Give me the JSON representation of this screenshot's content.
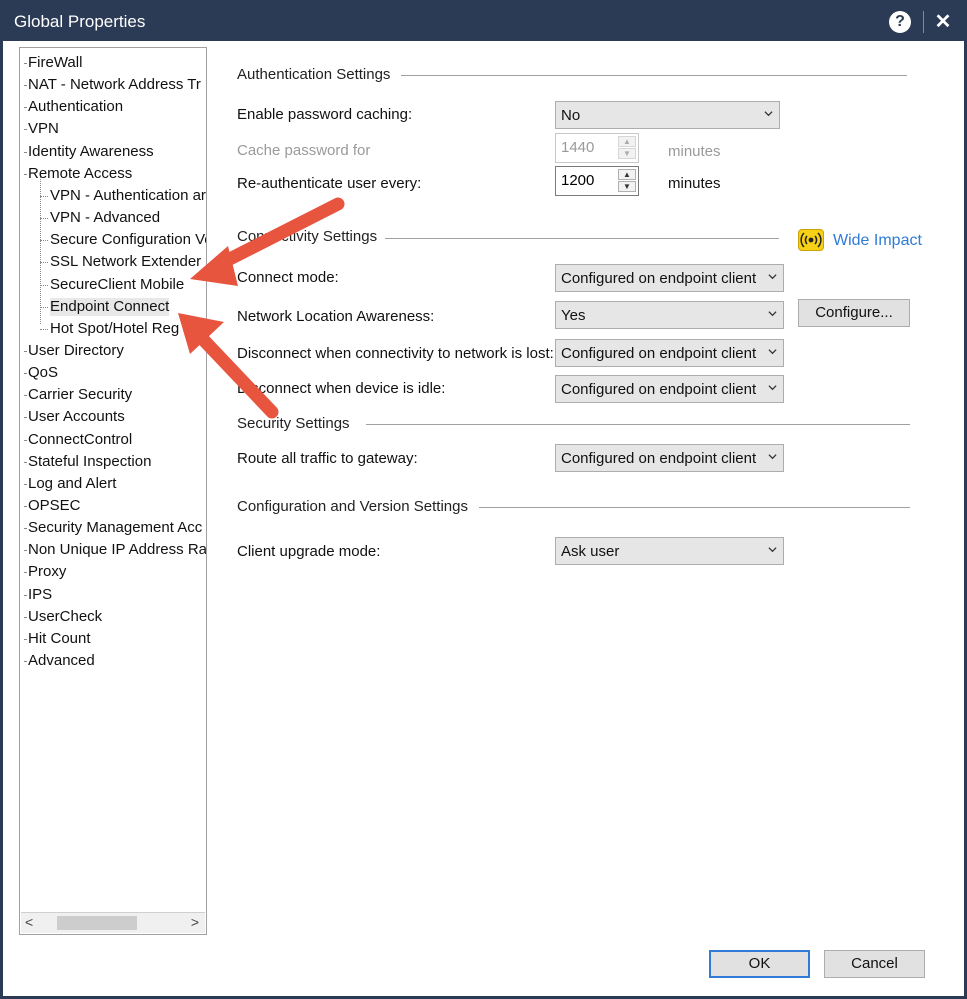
{
  "window": {
    "title": "Global Properties",
    "help_glyph": "?",
    "close_glyph": "✕"
  },
  "tree": {
    "items": [
      "FireWall",
      "NAT - Network Address Tr",
      "Authentication",
      "VPN",
      "Identity Awareness",
      "Remote Access",
      "VPN - Authentication ar",
      "VPN - Advanced",
      "Secure Configuration Ve",
      "SSL Network Extender",
      "SecureClient Mobile",
      "Endpoint Connect",
      "Hot Spot/Hotel Reg",
      "User Directory",
      "QoS",
      "Carrier Security",
      "User Accounts",
      "ConnectControl",
      "Stateful Inspection",
      "Log and Alert",
      "OPSEC",
      "Security Management Acc",
      "Non Unique IP Address Ra",
      "Proxy",
      "IPS",
      "UserCheck",
      "Hit Count",
      "Advanced"
    ],
    "selected": "Endpoint Connect",
    "scroll_left": "<",
    "scroll_right": ">"
  },
  "sections": {
    "authentication": "Authentication Settings",
    "connectivity": "Connectivity Settings",
    "security": "Security Settings",
    "config_version": "Configuration and Version Settings"
  },
  "fields": {
    "enable_password_caching": {
      "label": "Enable password caching:",
      "value": "No"
    },
    "cache_password_for": {
      "label": "Cache password for",
      "value": "1440",
      "unit": "minutes"
    },
    "reauthenticate": {
      "label": "Re-authenticate user every:",
      "value": "1200",
      "unit": "minutes"
    },
    "connect_mode": {
      "label": "Connect mode:",
      "value": "Configured on endpoint client"
    },
    "network_location_awareness": {
      "label": "Network Location Awareness:",
      "value": "Yes",
      "button": "Configure..."
    },
    "disconnect_network_lost": {
      "label": "Disconnect when connectivity to network is lost:",
      "value": "Configured on endpoint client"
    },
    "disconnect_idle": {
      "label": "Disconnect when device is idle:",
      "value": "Configured on endpoint client"
    },
    "route_all_traffic": {
      "label": "Route all traffic to gateway:",
      "value": "Configured on endpoint client"
    },
    "client_upgrade_mode": {
      "label": "Client upgrade mode:",
      "value": "Ask user"
    }
  },
  "wide_impact": {
    "label": "Wide Impact",
    "icon": "broadcast-icon",
    "icon_color": "#f7d117"
  },
  "footer": {
    "ok": "OK",
    "cancel": "Cancel"
  },
  "colors": {
    "title_bar": "#2b3a55",
    "accent": "#2f7bd6",
    "annotation_arrow": "#e8553f"
  }
}
